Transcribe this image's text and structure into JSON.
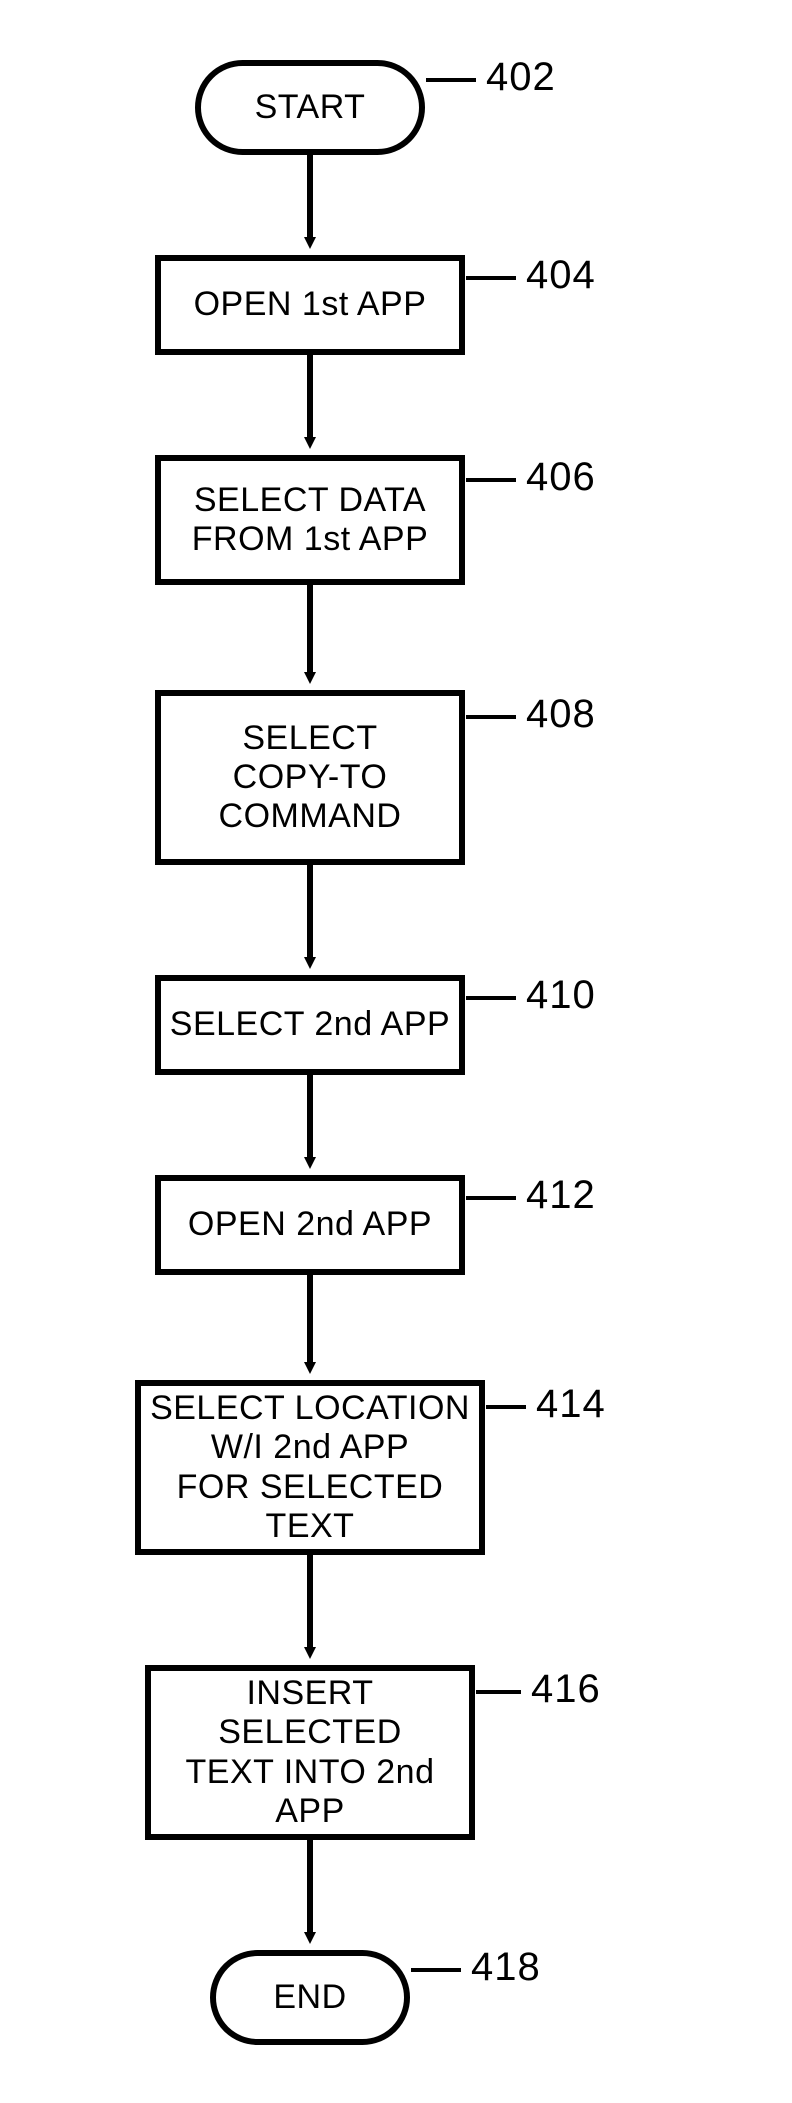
{
  "nodes": {
    "start": {
      "text": "START",
      "ref": "402"
    },
    "s1": {
      "text": "OPEN 1st APP",
      "ref": "404"
    },
    "s2": {
      "text": "SELECT DATA\nFROM 1st APP",
      "ref": "406"
    },
    "s3": {
      "text": "SELECT\nCOPY-TO\nCOMMAND",
      "ref": "408"
    },
    "s4": {
      "text": "SELECT 2nd APP",
      "ref": "410"
    },
    "s5": {
      "text": "OPEN 2nd APP",
      "ref": "412"
    },
    "s6": {
      "text": "SELECT LOCATION\nW/I 2nd APP\nFOR SELECTED TEXT",
      "ref": "414"
    },
    "s7": {
      "text": "INSERT SELECTED\nTEXT INTO 2nd\nAPP",
      "ref": "416"
    },
    "end": {
      "text": "END",
      "ref": "418"
    }
  }
}
